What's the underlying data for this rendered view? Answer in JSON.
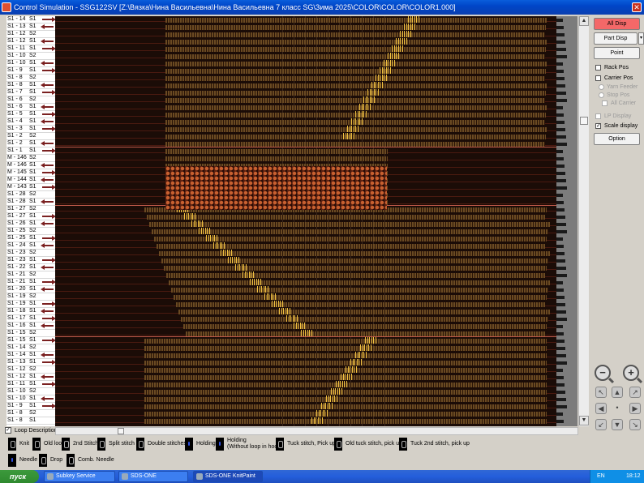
{
  "window": {
    "title": "Control Simulation - SSG122SV [Z:\\Вязка\\Нина Васильевна\\Нина Васильевна 7 класс SG\\Зима 2025\\COLOR\\COLOR\\COLOR1.000]",
    "close_glyph": "✕"
  },
  "rows": [
    {
      "name": "S1 - 14",
      "sys": "S1",
      "dir": "right"
    },
    {
      "name": "S1 - 13",
      "sys": "S1",
      "dir": "left"
    },
    {
      "name": "S1 - 12",
      "sys": "S2",
      "dir": ""
    },
    {
      "name": "S1 - 12",
      "sys": "S1",
      "dir": "left"
    },
    {
      "name": "S1 - 11",
      "sys": "S1",
      "dir": "right"
    },
    {
      "name": "S1 - 10",
      "sys": "S2",
      "dir": ""
    },
    {
      "name": "S1 - 10",
      "sys": "S1",
      "dir": "left"
    },
    {
      "name": "S1 - 9",
      "sys": "S1",
      "dir": "right"
    },
    {
      "name": "S1 - 8",
      "sys": "S2",
      "dir": ""
    },
    {
      "name": "S1 - 8",
      "sys": "S1",
      "dir": "left"
    },
    {
      "name": "S1 - 7",
      "sys": "S1",
      "dir": "right"
    },
    {
      "name": "S1 - 6",
      "sys": "S2",
      "dir": ""
    },
    {
      "name": "S1 - 6",
      "sys": "S1",
      "dir": "left"
    },
    {
      "name": "S1 - 5",
      "sys": "S1",
      "dir": "right"
    },
    {
      "name": "S1 - 4",
      "sys": "S1",
      "dir": "left"
    },
    {
      "name": "S1 - 3",
      "sys": "S1",
      "dir": "right"
    },
    {
      "name": "S1 - 2",
      "sys": "S2",
      "dir": ""
    },
    {
      "name": "S1 - 2",
      "sys": "S1",
      "dir": "left"
    },
    {
      "name": "S1 - 1",
      "sys": "S1",
      "dir": "right"
    },
    {
      "name": "M - 146",
      "sys": "S2",
      "dir": ""
    },
    {
      "name": "M - 146",
      "sys": "S1",
      "dir": "left"
    },
    {
      "name": "M - 145",
      "sys": "S1",
      "dir": "right"
    },
    {
      "name": "M - 144",
      "sys": "S1",
      "dir": "left"
    },
    {
      "name": "M - 143",
      "sys": "S1",
      "dir": "right"
    },
    {
      "name": "S1 - 28",
      "sys": "S2",
      "dir": ""
    },
    {
      "name": "S1 - 28",
      "sys": "S1",
      "dir": "left"
    },
    {
      "name": "S1 - 27",
      "sys": "S2",
      "dir": ""
    },
    {
      "name": "S1 - 27",
      "sys": "S1",
      "dir": "right"
    },
    {
      "name": "S1 - 26",
      "sys": "S1",
      "dir": "left"
    },
    {
      "name": "S1 - 25",
      "sys": "S2",
      "dir": ""
    },
    {
      "name": "S1 - 25",
      "sys": "S1",
      "dir": "right"
    },
    {
      "name": "S1 - 24",
      "sys": "S1",
      "dir": "left"
    },
    {
      "name": "S1 - 23",
      "sys": "S2",
      "dir": ""
    },
    {
      "name": "S1 - 23",
      "sys": "S1",
      "dir": "right"
    },
    {
      "name": "S1 - 22",
      "sys": "S1",
      "dir": "left"
    },
    {
      "name": "S1 - 21",
      "sys": "S2",
      "dir": ""
    },
    {
      "name": "S1 - 21",
      "sys": "S1",
      "dir": "right"
    },
    {
      "name": "S1 - 20",
      "sys": "S1",
      "dir": "left"
    },
    {
      "name": "S1 - 19",
      "sys": "S2",
      "dir": ""
    },
    {
      "name": "S1 - 19",
      "sys": "S1",
      "dir": "right"
    },
    {
      "name": "S1 - 18",
      "sys": "S1",
      "dir": "left"
    },
    {
      "name": "S1 - 17",
      "sys": "S1",
      "dir": "right"
    },
    {
      "name": "S1 - 16",
      "sys": "S1",
      "dir": "left"
    },
    {
      "name": "S1 - 15",
      "sys": "S2",
      "dir": ""
    },
    {
      "name": "S1 - 15",
      "sys": "S1",
      "dir": "right"
    },
    {
      "name": "S1 - 14",
      "sys": "S2",
      "dir": ""
    },
    {
      "name": "S1 - 14",
      "sys": "S1",
      "dir": "left"
    },
    {
      "name": "S1 - 13",
      "sys": "S1",
      "dir": "right"
    },
    {
      "name": "S1 - 12",
      "sys": "S2",
      "dir": ""
    },
    {
      "name": "S1 - 12",
      "sys": "S1",
      "dir": "left"
    },
    {
      "name": "S1 - 11",
      "sys": "S1",
      "dir": "right"
    },
    {
      "name": "S1 - 10",
      "sys": "S2",
      "dir": ""
    },
    {
      "name": "S1 - 10",
      "sys": "S1",
      "dir": "left"
    },
    {
      "name": "S1 - 9",
      "sys": "S1",
      "dir": "right"
    },
    {
      "name": "S1 - 8",
      "sys": "S2",
      "dir": ""
    },
    {
      "name": "S1 - 8",
      "sys": "S1",
      "dir": ""
    }
  ],
  "panel": {
    "all_disp": "All Disp",
    "part_disp": "Part Disp",
    "part_disp_arrow": "▾",
    "point": "Point",
    "rack_pos": "Rack Pos",
    "carrier_pos": "Carrier Pos",
    "yarn_feeder": "Yarn Feeder",
    "stop_pos": "Stop Pos",
    "all_carrier": "All Carrier",
    "lp_display": "LP Display",
    "scale_display": "Scale display",
    "scale_display_checked": "✓",
    "option": "Option"
  },
  "nav": {
    "zoom_out": "−",
    "zoom_in": "+",
    "up_left": "↖",
    "up": "▲",
    "up_right": "↗",
    "left": "◀",
    "center": "•",
    "right": "▶",
    "down_left": "↙",
    "down": "▼",
    "down_right": "↘"
  },
  "scroll": {
    "up": "▲",
    "down": "▼",
    "left": "◀",
    "right": "▶"
  },
  "loop_description": {
    "label": "Loop Description",
    "checked": "✓"
  },
  "legend": [
    {
      "label": "Knit"
    },
    {
      "label": "Old loop"
    },
    {
      "label": "2nd Stitch"
    },
    {
      "label": "Split stitch"
    },
    {
      "label": "Double stitches"
    },
    {
      "label": "Holding"
    },
    {
      "label": "Holding",
      "sub": "(Without loop in hook)"
    },
    {
      "label": "Tuck stitch, Pick up"
    },
    {
      "label": "Old tuck stitch, pick up"
    },
    {
      "label": "Tuck 2nd stitch, pick up"
    },
    {
      "label": "Needle"
    },
    {
      "label": "Drop"
    },
    {
      "label": "Comb. Needle"
    }
  ],
  "taskbar": {
    "start": "пуск",
    "items": [
      "Subkey Service",
      "SDS-ONE",
      "SDS-ONE KnitPaint"
    ],
    "lang": "EN",
    "clock": "18:12"
  },
  "colors": {
    "canvas_bg": "#1b0c07",
    "yarn": "#6a4a22",
    "pattern": "#c86030",
    "stitch_mark": "#f0c040",
    "all_disp_active": "#f46868"
  }
}
